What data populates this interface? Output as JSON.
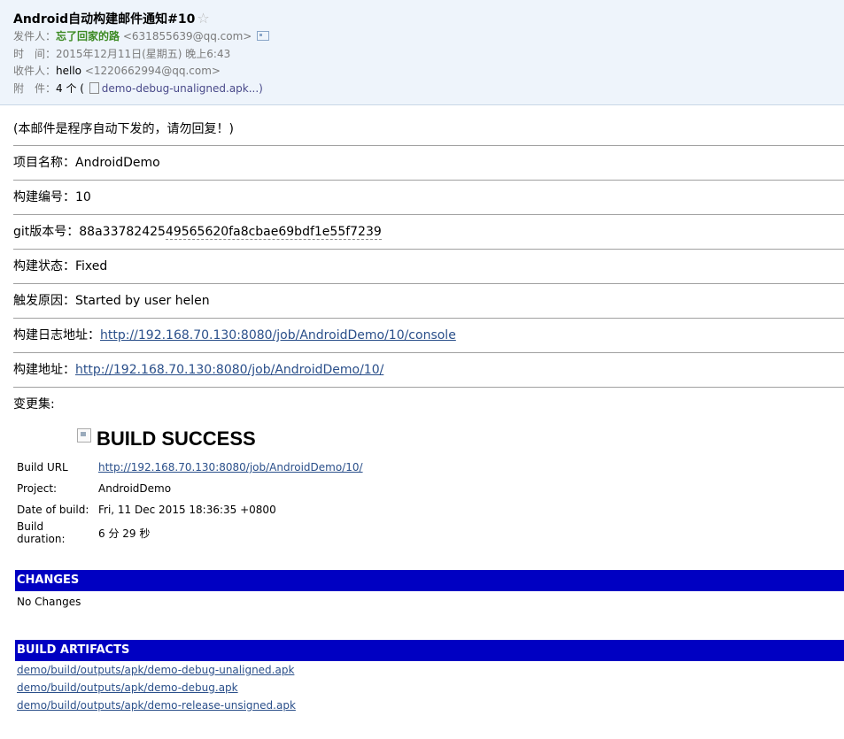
{
  "header": {
    "subject": "Android自动构建邮件通知#10",
    "star": "☆",
    "from_label": "发件人：",
    "from_name": "忘了回家的路",
    "from_email": "<631855639@qq.com>",
    "time_label": "时　间：",
    "time_value": "2015年12月11日(星期五) 晚上6:43",
    "to_label": "收件人：",
    "to_name": "hello",
    "to_email": "<1220662994@qq.com>",
    "attach_label": "附　件：",
    "attach_count": "4 个 (",
    "attach_file": "demo-debug-unaligned.apk...)",
    "icons": [
      "star-icon",
      "contact-card-icon",
      "file-icon"
    ]
  },
  "body": {
    "notice": "(本邮件是程序自动下发的，请勿回复！)",
    "project_label": "项目名称：",
    "project_value": "AndroidDemo",
    "build_no_label": "构建编号：",
    "build_no_value": "10",
    "git_label": "git版本号：",
    "git_value_a": "88a33782425",
    "git_value_b": "49565620fa8cbae69bdf1e55f7239",
    "status_label": "构建状态：",
    "status_value": "Fixed",
    "cause_label": "触发原因：",
    "cause_value": "Started by user helen",
    "log_label": "构建日志地址：",
    "log_url": "http://192.168.70.130:8080/job/AndroidDemo/10/console",
    "build_url_label": "构建地址：",
    "build_url": "http://192.168.70.130:8080/job/AndroidDemo/10/",
    "changeset_label": "变更集:"
  },
  "report": {
    "title": "BUILD SUCCESS",
    "build_url_key": "Build URL",
    "build_url_value": "http://192.168.70.130:8080/job/AndroidDemo/10/",
    "project_key": "Project:",
    "project_value": "AndroidDemo",
    "date_key": "Date of build:",
    "date_value": "Fri, 11 Dec 2015 18:36:35 +0800",
    "duration_key": "Build duration:",
    "duration_value": "6 分 29 秒",
    "changes_heading": "CHANGES",
    "changes_text": "No Changes",
    "artifacts_heading": "BUILD ARTIFACTS",
    "artifacts": [
      "demo/build/outputs/apk/demo-debug-unaligned.apk",
      "demo/build/outputs/apk/demo-debug.apk",
      "demo/build/outputs/apk/demo-release-unsigned.apk"
    ],
    "colors": {
      "bar_bg": "#0000c2",
      "link": "#2a4f8a",
      "sender": "#3c8a23"
    }
  }
}
